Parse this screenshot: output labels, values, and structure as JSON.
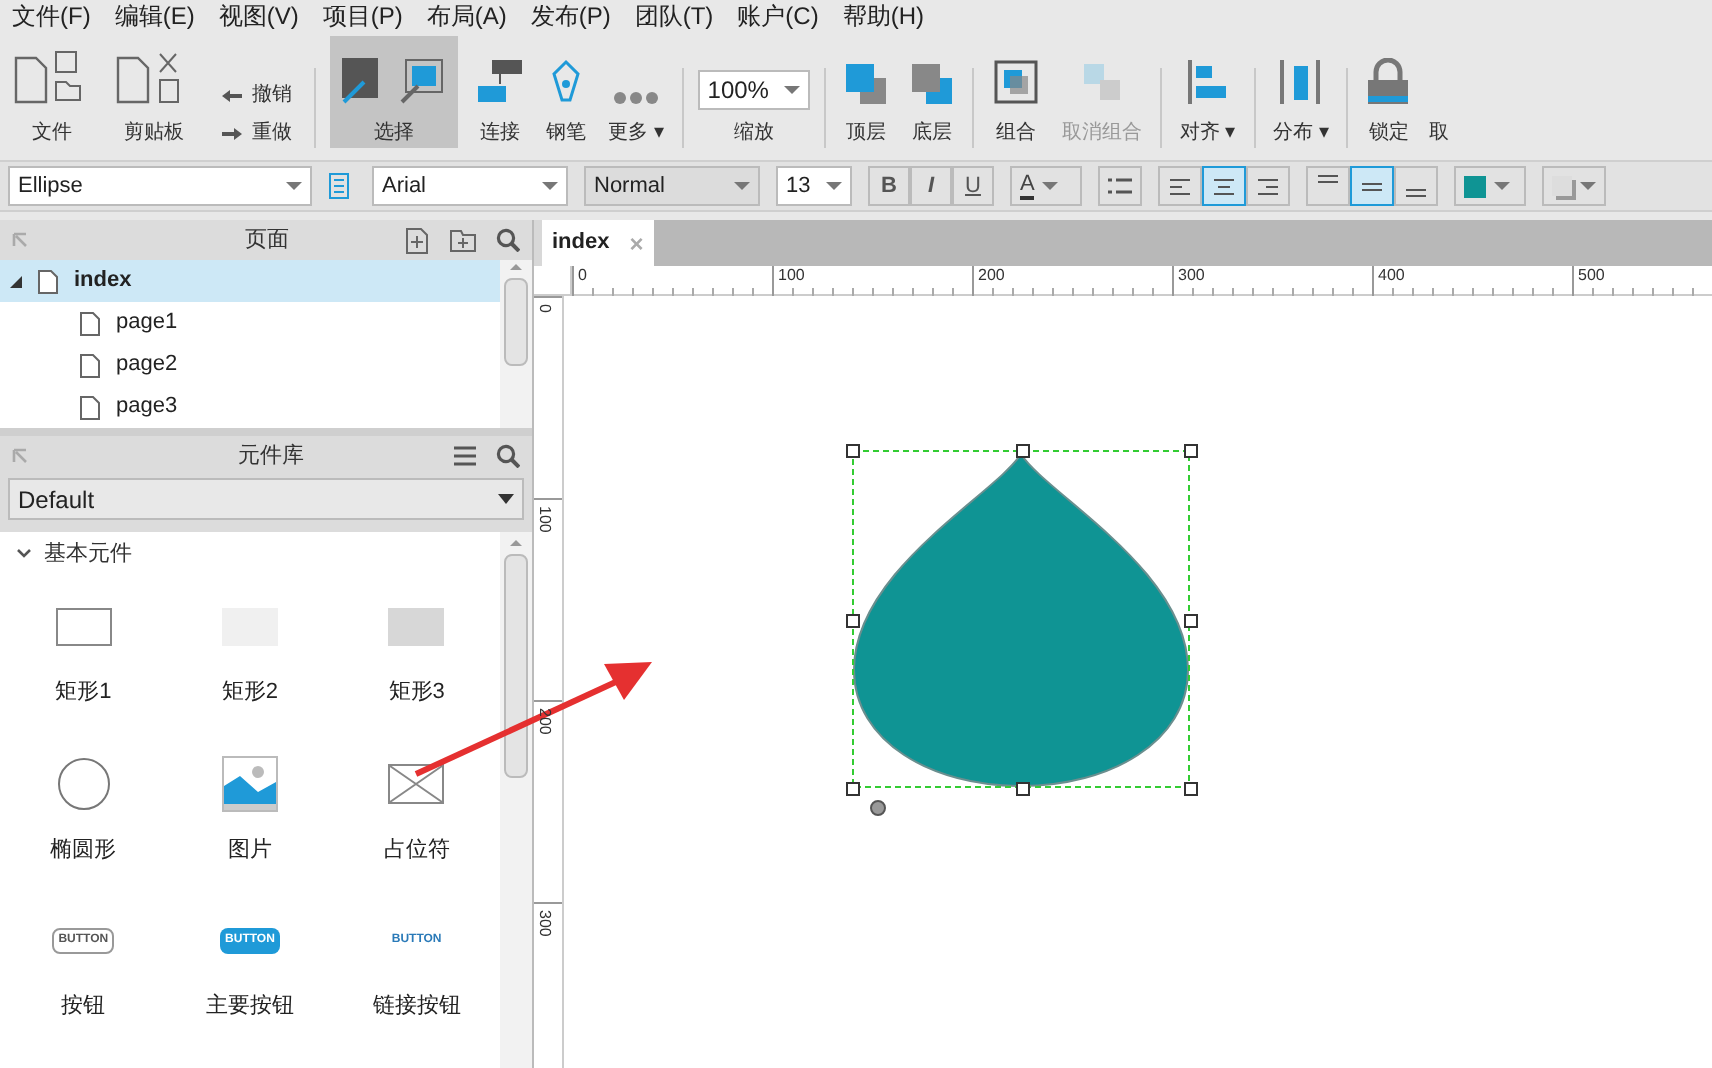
{
  "menu": [
    "文件(F)",
    "编辑(E)",
    "视图(V)",
    "项目(P)",
    "布局(A)",
    "发布(P)",
    "团队(T)",
    "账户(C)",
    "帮助(H)"
  ],
  "toolbar": [
    {
      "label": "文件",
      "selected": false,
      "disabled": false
    },
    {
      "label": "剪贴板",
      "selected": false,
      "disabled": false
    },
    {
      "undo": "撤销",
      "redo": "重做",
      "selected": false,
      "disabled": false
    },
    {
      "label": "选择",
      "selected": true,
      "disabled": false
    },
    {
      "label": "连接",
      "selected": false,
      "disabled": false
    },
    {
      "label": "钢笔",
      "selected": false,
      "disabled": false
    },
    {
      "label": "更多",
      "caret": "▾",
      "selected": false,
      "disabled": false
    },
    {
      "value": "100%",
      "label": "缩放",
      "selected": false,
      "disabled": false
    },
    {
      "label": "顶层",
      "selected": false,
      "disabled": false
    },
    {
      "label": "底层",
      "selected": false,
      "disabled": false
    },
    {
      "label": "组合",
      "selected": false,
      "disabled": false
    },
    {
      "label": "取消组合",
      "selected": false,
      "disabled": true
    },
    {
      "label": "对齐",
      "caret": "▾",
      "selected": false,
      "disabled": false
    },
    {
      "label": "分布",
      "caret": "▾",
      "selected": false,
      "disabled": false
    },
    {
      "label": "锁定",
      "selected": false,
      "disabled": false
    },
    {
      "label": "取",
      "selected": false,
      "disabled": false
    }
  ],
  "format_bar": {
    "shape": "Ellipse",
    "font": "Arial",
    "weight": "Normal",
    "size": "13",
    "bold": "B",
    "italic": "I",
    "underline": "U",
    "font_color": "A",
    "h_align": [
      {
        "selected": false
      },
      {
        "selected": true
      },
      {
        "selected": false
      }
    ],
    "v_align": [
      {
        "selected": false
      },
      {
        "selected": true
      },
      {
        "selected": false
      }
    ]
  },
  "pages_panel": {
    "title": "页面",
    "tree": [
      {
        "label": "index",
        "selected": true,
        "expanded": true,
        "children": [
          {
            "label": "page1",
            "selected": false
          },
          {
            "label": "page2",
            "selected": false
          },
          {
            "label": "page3",
            "selected": false
          }
        ]
      }
    ]
  },
  "library_panel": {
    "title": "元件库",
    "library": "Default",
    "section": {
      "title": "基本元件",
      "expanded": true,
      "items": [
        {
          "kind": "rect1",
          "label": "矩形1"
        },
        {
          "kind": "rect2",
          "label": "矩形2"
        },
        {
          "kind": "rect3",
          "label": "矩形3"
        },
        {
          "kind": "ellipse",
          "label": "椭圆形"
        },
        {
          "kind": "image",
          "label": "图片"
        },
        {
          "kind": "placeholder",
          "label": "占位符"
        },
        {
          "kind": "button",
          "label": "按钮",
          "text": "BUTTON"
        },
        {
          "kind": "primary",
          "label": "主要按钮",
          "text": "BUTTON"
        },
        {
          "kind": "link",
          "label": "链接按钮",
          "text": "BUTTON"
        }
      ]
    }
  },
  "canvas": {
    "tab": {
      "label": "index",
      "close": "×",
      "selected": true
    },
    "h_ruler": [
      "0",
      "100",
      "200",
      "300",
      "400",
      "500"
    ],
    "v_ruler": [
      "0",
      "100",
      "200",
      "300"
    ],
    "shape": {
      "selected": true
    }
  }
}
